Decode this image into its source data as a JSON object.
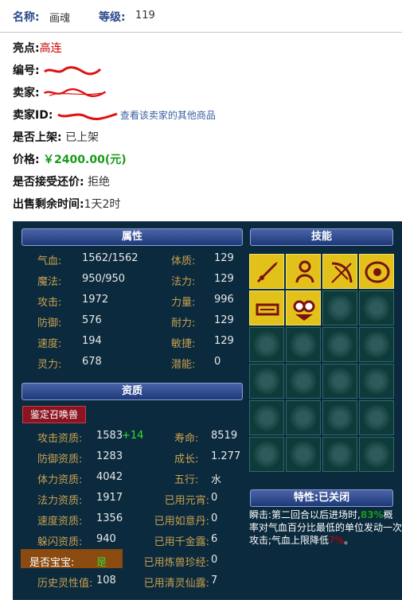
{
  "header": {
    "name_label": "名称:",
    "name_value": "画魂",
    "level_label": "等级:",
    "level_value": "119"
  },
  "info": {
    "highlight_label": "亮点:",
    "highlight_value": "高连",
    "id_label": "编号:",
    "seller_label": "卖家:",
    "seller_id_label": "卖家ID:",
    "seller_link": "查看该卖家的其他商品",
    "listed_label": "是否上架:",
    "listed_value": "已上架",
    "price_label": "价格:",
    "price_value": "￥2400.00(元)",
    "bargain_label": "是否接受还价:",
    "bargain_value": "拒绝",
    "remain_label": "出售剩余时间:",
    "remain_value": "1天2时"
  },
  "panel": {
    "attr_title": "属性",
    "skill_title": "技能",
    "qual_title": "资质",
    "appraise_button": "鉴定召唤兽",
    "attrs_left": [
      {
        "label": "气血:",
        "value": "1562/1562"
      },
      {
        "label": "魔法:",
        "value": "950/950"
      },
      {
        "label": "攻击:",
        "value": "1972"
      },
      {
        "label": "防御:",
        "value": "576"
      },
      {
        "label": "速度:",
        "value": "194"
      },
      {
        "label": "灵力:",
        "value": "678"
      }
    ],
    "attrs_right": [
      {
        "label": "体质:",
        "value": "129"
      },
      {
        "label": "法力:",
        "value": "129"
      },
      {
        "label": "力量:",
        "value": "996"
      },
      {
        "label": "耐力:",
        "value": "129"
      },
      {
        "label": "敏捷:",
        "value": "129"
      },
      {
        "label": "潜能:",
        "value": "0"
      }
    ],
    "quals_left": [
      {
        "label": "攻击资质:",
        "value": "1583",
        "extra": "+14"
      },
      {
        "label": "防御资质:",
        "value": "1283"
      },
      {
        "label": "体力资质:",
        "value": "4042"
      },
      {
        "label": "法力资质:",
        "value": "1917"
      },
      {
        "label": "速度资质:",
        "value": "1356"
      },
      {
        "label": "躲闪资质:",
        "value": "940"
      },
      {
        "label": "是否宝宝:",
        "value": "是"
      },
      {
        "label": "历史灵性值:",
        "value": "108"
      }
    ],
    "quals_right": [
      {
        "label": "寿命:",
        "value": "8519"
      },
      {
        "label": "成长:",
        "value": "1.277"
      },
      {
        "label": "五行:",
        "value": "水"
      },
      {
        "label": "已用元宵:",
        "value": "0"
      },
      {
        "label": "已用如意丹:",
        "value": "0"
      },
      {
        "label": "已用千金露:",
        "value": "6"
      },
      {
        "label": "已用炼兽珍经:",
        "value": "0"
      },
      {
        "label": "已用清灵仙露:",
        "value": "7"
      }
    ],
    "trait_title": "特性:已关闭",
    "trait_text_a": "瞬击:第二回合以后进场时,",
    "trait_pct": "83%",
    "trait_text_b": "概率对气血百分比最低的单位发动一次攻击;气血上限降低",
    "trait_pct2": "7%",
    "trait_text_c": "。",
    "skills": [
      "sword-skill-icon",
      "figure-skill-icon",
      "bow-skill-icon",
      "eye-skill-icon",
      "mouth-skill-icon",
      "owl-skill-icon"
    ],
    "colors": {
      "panel_bg": "#0b2a3d",
      "label": "#c8a050",
      "skill_bg": "#e2c21a"
    }
  }
}
